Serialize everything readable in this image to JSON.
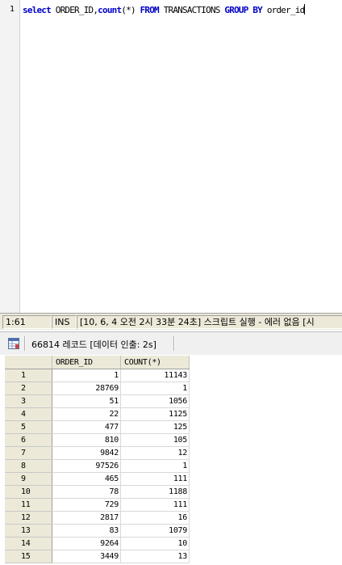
{
  "editor": {
    "line_number": "1",
    "sql": {
      "kw_select": "select",
      "col_order_id": "ORDER_ID,",
      "fn_count": "count",
      "count_args": "(*)",
      "kw_from": "FROM",
      "table": "TRANSACTIONS",
      "kw_group_by": "GROUP BY",
      "group_col": "order_id"
    }
  },
  "statusbar": {
    "cursor_pos": "1:61",
    "mode": "INS",
    "message": "[10, 6, 4 오전 2시 33분 24초] 스크립트 실행 - 에러 없음 [시"
  },
  "results": {
    "record_count_label": "66814 레코드 [데이터 인출: 2s]",
    "columns": [
      "",
      "ORDER_ID",
      "COUNT(*)"
    ],
    "rows": [
      [
        "1",
        "1",
        "11143"
      ],
      [
        "2",
        "28769",
        "1"
      ],
      [
        "3",
        "51",
        "1056"
      ],
      [
        "4",
        "22",
        "1125"
      ],
      [
        "5",
        "477",
        "125"
      ],
      [
        "6",
        "810",
        "105"
      ],
      [
        "7",
        "9842",
        "12"
      ],
      [
        "8",
        "97526",
        "1"
      ],
      [
        "9",
        "465",
        "111"
      ],
      [
        "10",
        "78",
        "1188"
      ],
      [
        "11",
        "729",
        "111"
      ],
      [
        "12",
        "2817",
        "16"
      ],
      [
        "13",
        "83",
        "1079"
      ],
      [
        "14",
        "9264",
        "10"
      ],
      [
        "15",
        "3449",
        "13"
      ]
    ]
  }
}
